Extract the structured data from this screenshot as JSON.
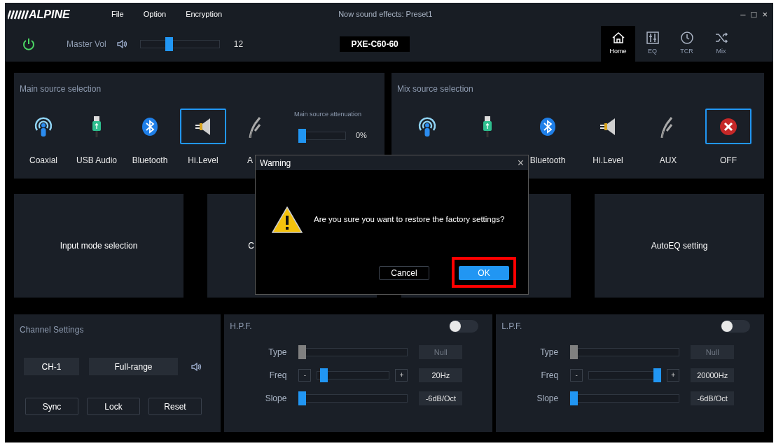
{
  "logo": "ALPINE",
  "menu": [
    "File",
    "Option",
    "Encryption"
  ],
  "window": {
    "title": "Now sound effects: Preset1",
    "controls": [
      "–",
      "□",
      "×"
    ]
  },
  "toolbar": {
    "power_on": true,
    "master_vol": {
      "label": "Master Vol",
      "level": 0.35,
      "reading": "12"
    },
    "device": "PXE-C60-60",
    "tabs": [
      {
        "label": "Home",
        "kind": "home",
        "selected": true
      },
      {
        "label": "EQ",
        "kind": "eq",
        "selected": false
      },
      {
        "label": "TCR",
        "kind": "tcr",
        "selected": false
      },
      {
        "label": "Mix",
        "kind": "mix",
        "selected": false
      }
    ]
  },
  "main_source": {
    "title": "Main source selection",
    "items": [
      {
        "label": "Coaxial",
        "kind": "coaxial",
        "selected": false
      },
      {
        "label": "USB Audio",
        "kind": "usb",
        "selected": false
      },
      {
        "label": "Bluetooth",
        "kind": "bluetooth",
        "selected": false
      },
      {
        "label": "Hi.Level",
        "kind": "hilevel",
        "selected": true
      },
      {
        "label": "A",
        "kind": "aux",
        "selected": false
      }
    ],
    "attenuation": {
      "label": "Main source attenuation",
      "level": 0,
      "reading": "0%"
    }
  },
  "mix_source": {
    "title": "Mix source selection",
    "items": [
      {
        "kind": "coaxial",
        "selected": false
      },
      {
        "kind": "usb",
        "selected": false
      },
      {
        "label": "Bluetooth",
        "kind": "bluetooth",
        "selected": false
      },
      {
        "label": "Hi.Level",
        "kind": "hilevel",
        "selected": false
      },
      {
        "label": "AUX",
        "kind": "aux",
        "selected": false
      },
      {
        "label": "OFF",
        "kind": "off",
        "selected": true
      }
    ]
  },
  "cards": [
    {
      "kind": "card",
      "label": "Input mode selection"
    },
    {
      "kind": "card",
      "label": "C"
    },
    {
      "kind": "card"
    },
    {
      "kind": "card",
      "label": "AutoEQ setting"
    }
  ],
  "channel_settings": {
    "title": "Channel Settings",
    "channel": "CH-1",
    "range": "Full-range",
    "buttons": [
      "Sync",
      "Lock",
      "Reset"
    ]
  },
  "filters": [
    {
      "title": "H.P.F.",
      "on": false,
      "rows": [
        {
          "label": "Type",
          "kind": "slider",
          "disabled": true,
          "level": 0,
          "value": "Null"
        },
        {
          "label": "Freq",
          "kind": "stepper",
          "disabled": false,
          "level": 0.05,
          "value": "20Hz",
          "minus": "-",
          "plus": "+"
        },
        {
          "label": "Slope",
          "kind": "slider",
          "disabled": false,
          "level": 0,
          "value": "-6dB/Oct"
        }
      ]
    },
    {
      "title": "L.P.F.",
      "on": false,
      "rows": [
        {
          "label": "Type",
          "kind": "slider",
          "disabled": true,
          "level": 0,
          "value": "Null"
        },
        {
          "label": "Freq",
          "kind": "stepper",
          "disabled": false,
          "level": 1,
          "value": "20000Hz",
          "minus": "-",
          "plus": "+"
        },
        {
          "label": "Slope",
          "kind": "slider",
          "disabled": false,
          "level": 0,
          "value": "-6dB/Oct"
        }
      ]
    }
  ],
  "dialog": {
    "title": "Warning",
    "close": "×",
    "message": "Are you sure you want to restore the factory settings?",
    "buttons": [
      {
        "label": "Cancel",
        "kind": "secondary",
        "highlighted": false
      },
      {
        "label": "OK",
        "kind": "primary",
        "highlighted": true
      }
    ]
  }
}
